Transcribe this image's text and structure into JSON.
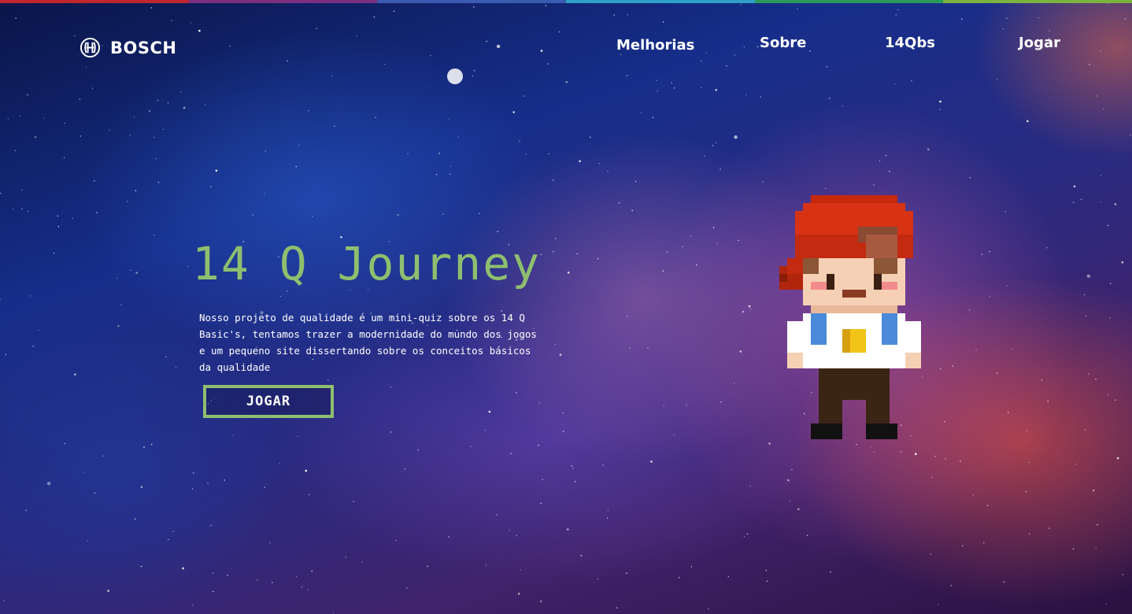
{
  "header": {
    "brand": "BOSCH",
    "brand_icon": "bosch-armature-icon",
    "nav": {
      "items": [
        {
          "label": "Melhorias"
        },
        {
          "label": "Sobre"
        },
        {
          "label": "14Qbs"
        },
        {
          "label": "Jogar"
        }
      ]
    }
  },
  "hero": {
    "title": "14 Q Journey",
    "description": "Nosso projeto de qualidade é um mini-quiz sobre os 14 Q Basic's, tentamos trazer a modernidade do mundo dos jogos e um pequeno site dissertando sobre os conceitos básicos da qualidade",
    "button_label": "JOGAR",
    "character_icon": "pixel-boy-character-icon"
  },
  "colors": {
    "accent": "#8fbf6e",
    "text": "#ffffff",
    "topline": [
      "#c0262d",
      "#7b2f7e",
      "#3b5bb0",
      "#2fa0c8",
      "#2b9a5a",
      "#7bb33f"
    ]
  }
}
